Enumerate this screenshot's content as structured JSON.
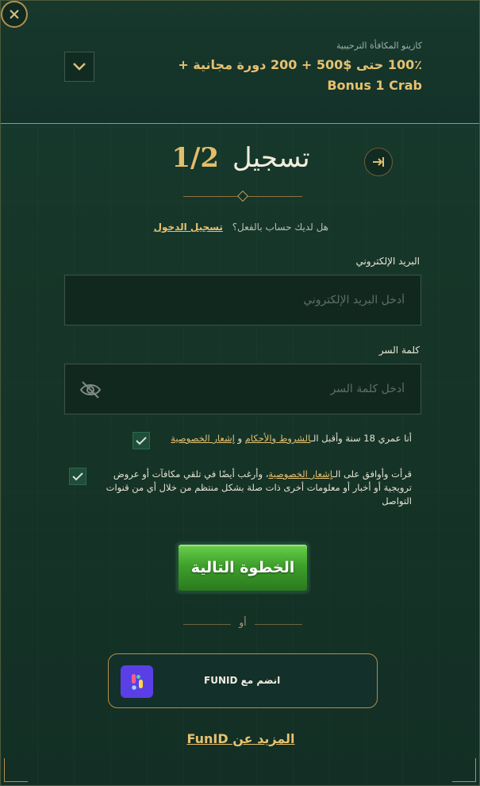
{
  "bonus": {
    "subtitle": "كازينو المكافأة الترحيبية",
    "title": "100٪ حتى $500 + 200 دورة مجانية + Bonus 1 Crab"
  },
  "header": {
    "title": "تسجيل",
    "step": "1/2"
  },
  "login": {
    "question": "هل لديك حساب بالفعل؟",
    "link": "تسجيل الدخول"
  },
  "email": {
    "label": "البريد الإلكتروني",
    "placeholder": "أدخل البريد الإلكتروني"
  },
  "password": {
    "label": "كلمة السر",
    "placeholder": "أدخل كلمة السر"
  },
  "consent_age": {
    "checked": true,
    "text_before": "أنا عمري 18 سنة وأقبل الـ",
    "terms_link": "الشروط والأحكام",
    "and": "و",
    "privacy_link": "إشعار الخصوصية"
  },
  "consent_marketing": {
    "checked": true,
    "text_before": "قرأت وأوافق على الـ",
    "privacy_link": "إشعار الخصوصية",
    "text_after": "، وأرغب أيضًا في تلقي مكافآت أو عروض ترويجية أو أخبار أو معلومات أخرى ذات صلة بشكل منتظم من خلال أي من قنوات التواصل"
  },
  "next_button": "الخطوة التالية",
  "or_text": "أو",
  "funid": {
    "label": "انضم مع FUNID",
    "more_link": "المزيد عن FunID"
  },
  "colors": {
    "background": "#163528",
    "accent_gold": "#e6c170",
    "button_green": "#3ea12c",
    "funid_purple": "#5a3fe6"
  }
}
